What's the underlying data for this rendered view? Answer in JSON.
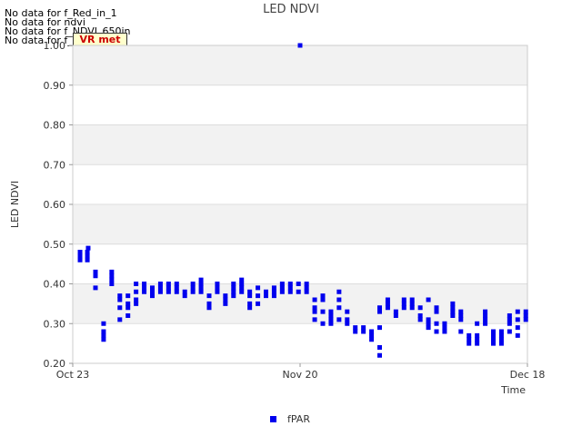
{
  "no_data_messages": [
    "No data for f_Red_in_1",
    "No data for ndvi",
    "No data for f_NDVI_650in",
    "No data for f_qcr_20"
  ],
  "logo_text": "VR met",
  "chart_data": {
    "type": "scatter",
    "title": "LED NDVI",
    "xlabel": "Time",
    "ylabel": "LED NDVI",
    "ylim": [
      0.2,
      1.0
    ],
    "yticks": [
      "0.20",
      "0.30",
      "0.40",
      "0.50",
      "0.60",
      "0.70",
      "0.80",
      "0.90",
      "1.00"
    ],
    "x_range_days": [
      0,
      56
    ],
    "xticks": [
      {
        "label": "Oct 23",
        "day": 0
      },
      {
        "label": "Nov 20",
        "day": 28
      },
      {
        "label": "Dec 18",
        "day": 56
      }
    ],
    "grid": true,
    "legend_position": "bottom-center",
    "series": [
      {
        "name": "fPAR",
        "color": "#0000ee",
        "points": [
          [
            0.9,
            0.47
          ],
          [
            0.9,
            0.46
          ],
          [
            0.9,
            0.48
          ],
          [
            1.8,
            0.48
          ],
          [
            1.8,
            0.47
          ],
          [
            1.8,
            0.46
          ],
          [
            1.9,
            0.49
          ],
          [
            2.8,
            0.43
          ],
          [
            2.8,
            0.42
          ],
          [
            2.8,
            0.39
          ],
          [
            3.8,
            0.3
          ],
          [
            3.8,
            0.28
          ],
          [
            3.8,
            0.27
          ],
          [
            3.8,
            0.26
          ],
          [
            4.8,
            0.43
          ],
          [
            4.8,
            0.42
          ],
          [
            4.8,
            0.41
          ],
          [
            4.8,
            0.4
          ],
          [
            5.8,
            0.37
          ],
          [
            5.8,
            0.36
          ],
          [
            5.8,
            0.34
          ],
          [
            5.8,
            0.31
          ],
          [
            6.8,
            0.37
          ],
          [
            6.8,
            0.35
          ],
          [
            6.8,
            0.34
          ],
          [
            6.8,
            0.32
          ],
          [
            7.8,
            0.4
          ],
          [
            7.8,
            0.38
          ],
          [
            7.8,
            0.36
          ],
          [
            7.8,
            0.35
          ],
          [
            8.8,
            0.4
          ],
          [
            8.8,
            0.39
          ],
          [
            8.8,
            0.38
          ],
          [
            9.8,
            0.39
          ],
          [
            9.8,
            0.38
          ],
          [
            9.8,
            0.37
          ],
          [
            10.8,
            0.4
          ],
          [
            10.8,
            0.39
          ],
          [
            10.8,
            0.38
          ],
          [
            11.8,
            0.4
          ],
          [
            11.8,
            0.39
          ],
          [
            11.8,
            0.38
          ],
          [
            12.8,
            0.4
          ],
          [
            12.8,
            0.39
          ],
          [
            12.8,
            0.38
          ],
          [
            13.8,
            0.38
          ],
          [
            13.8,
            0.37
          ],
          [
            14.8,
            0.4
          ],
          [
            14.8,
            0.39
          ],
          [
            14.8,
            0.38
          ],
          [
            15.8,
            0.41
          ],
          [
            15.8,
            0.4
          ],
          [
            15.8,
            0.39
          ],
          [
            15.8,
            0.38
          ],
          [
            16.8,
            0.37
          ],
          [
            16.8,
            0.35
          ],
          [
            16.8,
            0.34
          ],
          [
            17.8,
            0.4
          ],
          [
            17.8,
            0.39
          ],
          [
            17.8,
            0.38
          ],
          [
            18.8,
            0.37
          ],
          [
            18.8,
            0.36
          ],
          [
            18.8,
            0.35
          ],
          [
            19.8,
            0.4
          ],
          [
            19.8,
            0.39
          ],
          [
            19.8,
            0.38
          ],
          [
            19.8,
            0.37
          ],
          [
            20.8,
            0.41
          ],
          [
            20.8,
            0.4
          ],
          [
            20.8,
            0.39
          ],
          [
            20.8,
            0.38
          ],
          [
            21.8,
            0.38
          ],
          [
            21.8,
            0.37
          ],
          [
            21.8,
            0.35
          ],
          [
            21.8,
            0.34
          ],
          [
            22.8,
            0.39
          ],
          [
            22.8,
            0.37
          ],
          [
            22.8,
            0.35
          ],
          [
            23.8,
            0.38
          ],
          [
            23.8,
            0.37
          ],
          [
            24.8,
            0.39
          ],
          [
            24.8,
            0.38
          ],
          [
            24.8,
            0.37
          ],
          [
            25.8,
            0.4
          ],
          [
            25.8,
            0.39
          ],
          [
            25.8,
            0.38
          ],
          [
            26.8,
            0.4
          ],
          [
            26.8,
            0.39
          ],
          [
            26.8,
            0.38
          ],
          [
            27.8,
            0.4
          ],
          [
            27.8,
            0.38
          ],
          [
            28,
            1.0
          ],
          [
            28.8,
            0.4
          ],
          [
            28.8,
            0.39
          ],
          [
            28.8,
            0.38
          ],
          [
            29.8,
            0.36
          ],
          [
            29.8,
            0.34
          ],
          [
            29.8,
            0.33
          ],
          [
            29.8,
            0.31
          ],
          [
            30.8,
            0.37
          ],
          [
            30.8,
            0.36
          ],
          [
            30.8,
            0.33
          ],
          [
            30.8,
            0.3
          ],
          [
            31.8,
            0.33
          ],
          [
            31.8,
            0.32
          ],
          [
            31.8,
            0.31
          ],
          [
            31.8,
            0.3
          ],
          [
            32.8,
            0.38
          ],
          [
            32.8,
            0.36
          ],
          [
            32.8,
            0.34
          ],
          [
            32.8,
            0.31
          ],
          [
            33.8,
            0.33
          ],
          [
            33.8,
            0.31
          ],
          [
            33.8,
            0.3
          ],
          [
            34.8,
            0.29
          ],
          [
            34.8,
            0.28
          ],
          [
            35.8,
            0.29
          ],
          [
            35.8,
            0.28
          ],
          [
            36.8,
            0.28
          ],
          [
            36.8,
            0.27
          ],
          [
            36.8,
            0.26
          ],
          [
            37.8,
            0.34
          ],
          [
            37.8,
            0.33
          ],
          [
            37.8,
            0.29
          ],
          [
            37.8,
            0.24
          ],
          [
            37.8,
            0.22
          ],
          [
            38.8,
            0.36
          ],
          [
            38.8,
            0.35
          ],
          [
            38.8,
            0.34
          ],
          [
            39.8,
            0.33
          ],
          [
            39.8,
            0.32
          ],
          [
            40.8,
            0.36
          ],
          [
            40.8,
            0.35
          ],
          [
            40.8,
            0.34
          ],
          [
            41.8,
            0.36
          ],
          [
            41.8,
            0.35
          ],
          [
            41.8,
            0.34
          ],
          [
            42.8,
            0.34
          ],
          [
            42.8,
            0.32
          ],
          [
            42.8,
            0.31
          ],
          [
            43.8,
            0.36
          ],
          [
            43.8,
            0.31
          ],
          [
            43.8,
            0.3
          ],
          [
            43.8,
            0.29
          ],
          [
            44.8,
            0.34
          ],
          [
            44.8,
            0.33
          ],
          [
            44.8,
            0.3
          ],
          [
            44.8,
            0.28
          ],
          [
            45.8,
            0.3
          ],
          [
            45.8,
            0.29
          ],
          [
            45.8,
            0.28
          ],
          [
            46.8,
            0.35
          ],
          [
            46.8,
            0.34
          ],
          [
            46.8,
            0.33
          ],
          [
            46.8,
            0.32
          ],
          [
            47.8,
            0.33
          ],
          [
            47.8,
            0.32
          ],
          [
            47.8,
            0.31
          ],
          [
            47.8,
            0.28
          ],
          [
            48.8,
            0.27
          ],
          [
            48.8,
            0.26
          ],
          [
            48.8,
            0.25
          ],
          [
            49.8,
            0.3
          ],
          [
            49.8,
            0.27
          ],
          [
            49.8,
            0.26
          ],
          [
            49.8,
            0.25
          ],
          [
            50.8,
            0.33
          ],
          [
            50.8,
            0.32
          ],
          [
            50.8,
            0.31
          ],
          [
            50.8,
            0.3
          ],
          [
            51.8,
            0.28
          ],
          [
            51.8,
            0.27
          ],
          [
            51.8,
            0.26
          ],
          [
            51.8,
            0.25
          ],
          [
            52.8,
            0.28
          ],
          [
            52.8,
            0.27
          ],
          [
            52.8,
            0.26
          ],
          [
            52.8,
            0.25
          ],
          [
            53.8,
            0.32
          ],
          [
            53.8,
            0.31
          ],
          [
            53.8,
            0.3
          ],
          [
            53.8,
            0.28
          ],
          [
            54.8,
            0.33
          ],
          [
            54.8,
            0.31
          ],
          [
            54.8,
            0.29
          ],
          [
            54.8,
            0.27
          ],
          [
            55.8,
            0.33
          ],
          [
            55.8,
            0.32
          ],
          [
            55.8,
            0.31
          ]
        ]
      }
    ]
  }
}
